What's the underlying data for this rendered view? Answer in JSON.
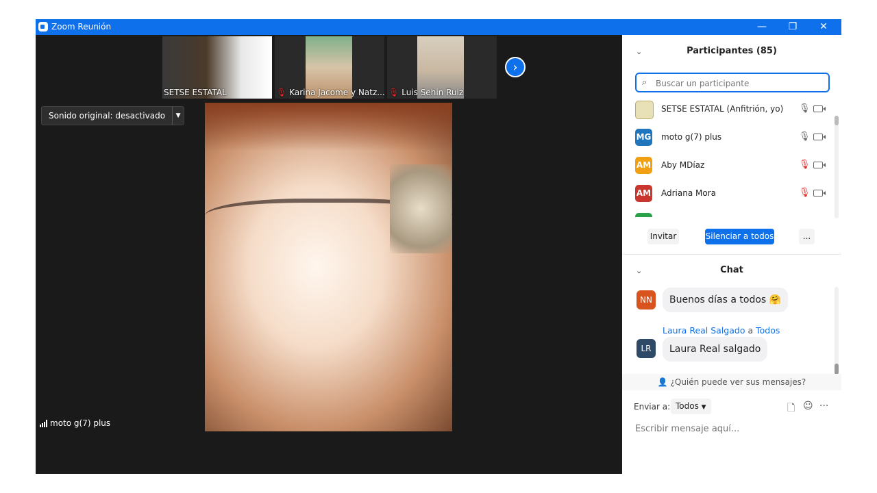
{
  "window": {
    "title": "Zoom Reunión",
    "controls": {
      "minimize": "—",
      "restore": "❐",
      "close": "✕"
    }
  },
  "thumbnails": [
    {
      "name": "SETSE ESTATAL",
      "muted": false,
      "mute_icon": "muted-mic-icon"
    },
    {
      "name": "Karina Jacome y Natz...",
      "muted": true,
      "mute_icon": "muted-mic-icon"
    },
    {
      "name": "Luis Sehin Ruiz",
      "muted": true,
      "mute_icon": "muted-mic-icon"
    }
  ],
  "next_page_icon": "›",
  "sound_original": {
    "label": "Sonido original: desactivado",
    "arrow": "▼"
  },
  "active_speaker": {
    "name": "moto g(7) plus"
  },
  "participants": {
    "title": "Participantes (85)",
    "search_placeholder": "Buscar un participante",
    "list": [
      {
        "initials": "",
        "name": "SETSE ESTATAL (Anfitrión, yo)",
        "avatar_color": "#e8e1b8",
        "mic": "unmuted"
      },
      {
        "initials": "MG",
        "name": "moto g(7) plus",
        "avatar_color": "#1f76bd",
        "mic": "unmuted"
      },
      {
        "initials": "AM",
        "name": "Aby MDíaz",
        "avatar_color": "#f0a012",
        "mic": "muted"
      },
      {
        "initials": "AM",
        "name": "Adriana Mora",
        "avatar_color": "#c8362e",
        "mic": "muted"
      }
    ],
    "buttons": {
      "invite": "Invitar",
      "mute_all": "Silenciar a todos",
      "more": "..."
    }
  },
  "chat": {
    "title": "Chat",
    "messages": [
      {
        "initials": "NN",
        "avatar_color": "#d9531e",
        "text": "Buenos días a todos",
        "emoji": "🤗"
      },
      {
        "initials": "LR",
        "avatar_color": "#2f4a66",
        "sender": "Laura Real Salgado",
        "to_word": "a",
        "recipient": "Todos",
        "text": "Laura Real salgado"
      }
    ],
    "who_can_see": "¿Quién puede ver sus mensajes?",
    "send_to_label": "Enviar a:",
    "send_to_value": "Todos",
    "input_placeholder": "Escribir mensaje aquí...",
    "more": "···"
  },
  "colors": {
    "accent": "#0e71eb",
    "video_bg": "#1a1a1a",
    "mute_red": "#e02828"
  }
}
